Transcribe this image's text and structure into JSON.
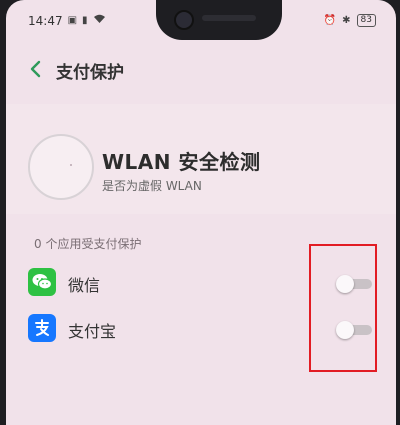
{
  "status_bar": {
    "time": "14:47",
    "battery": "83"
  },
  "header": {
    "title": "支付保护"
  },
  "wlan_check": {
    "title": "WLAN 安全检测",
    "subtitle": "是否为虚假 WLAN"
  },
  "section": {
    "label": "0 个应用受支付保护"
  },
  "apps": [
    {
      "name": "微信",
      "icon": "wechat-icon",
      "toggle_on": false
    },
    {
      "name": "支付宝",
      "icon": "alipay-icon",
      "toggle_on": false
    }
  ],
  "colors": {
    "background": "#f1e2ea",
    "highlight": "#e21c24",
    "wechat_green": "#2ec143",
    "alipay_blue": "#1677ff"
  }
}
